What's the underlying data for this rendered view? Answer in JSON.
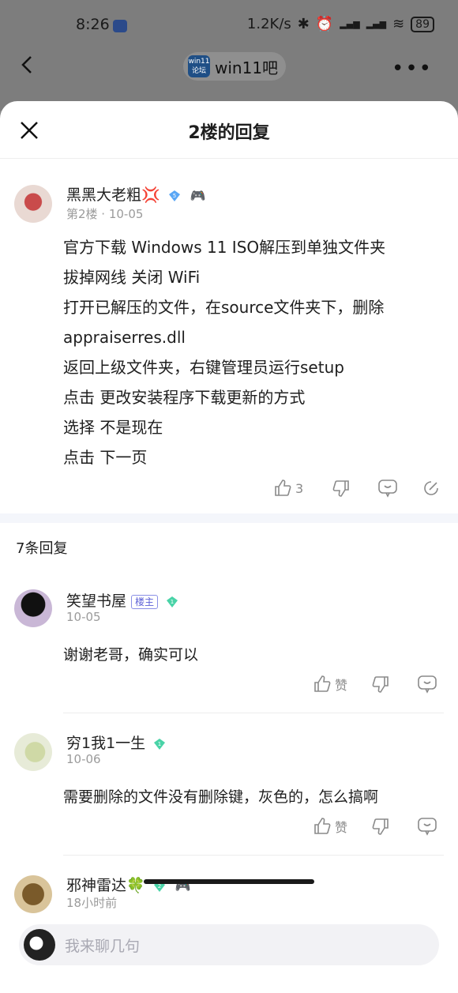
{
  "status": {
    "time": "8:26",
    "app_badge": "手",
    "net": "1.2K/s",
    "signal1": "HD",
    "signal2": "HD",
    "battery": "89"
  },
  "nav": {
    "forum_logo": "win11\n论坛",
    "forum_name": "win11吧"
  },
  "sheet": {
    "title": "2楼的回复"
  },
  "post": {
    "user": "黑黑大老粗💢",
    "level": "5",
    "meta": "第2楼 · 10-05",
    "lines": [
      "官方下载 Windows 11 ISO解压到单独文件夹",
      "拔掉网线 关闭 WiFi",
      "打开已解压的文件，在source文件夹下，删除",
      "appraiserres.dll",
      "返回上级文件夹，右键管理员运行setup",
      "点击 更改安装程序下载更新的方式",
      "选择 不是现在",
      "点击 下一页"
    ],
    "like_count": "3"
  },
  "replies_title": "7条回复",
  "replies": [
    {
      "user": "笑望书屋",
      "tag": "楼主",
      "level": "1",
      "date": "10-05",
      "text": "谢谢老哥，确实可以",
      "like": "赞"
    },
    {
      "user": "穷1我1一生",
      "level": "1",
      "date": "10-06",
      "text": "需要删除的文件没有删除键，灰色的，怎么搞啊",
      "like": "赞"
    },
    {
      "user": "邪神雷达🍀",
      "level": "2",
      "date": "18小时前"
    }
  ],
  "input": {
    "placeholder": "我来聊几句"
  },
  "colors": {
    "accent_badge": "#5aa7f5",
    "green_badge": "#49d3a7",
    "sheet_bg": "#ffffff",
    "band": "#f4f6fb"
  }
}
